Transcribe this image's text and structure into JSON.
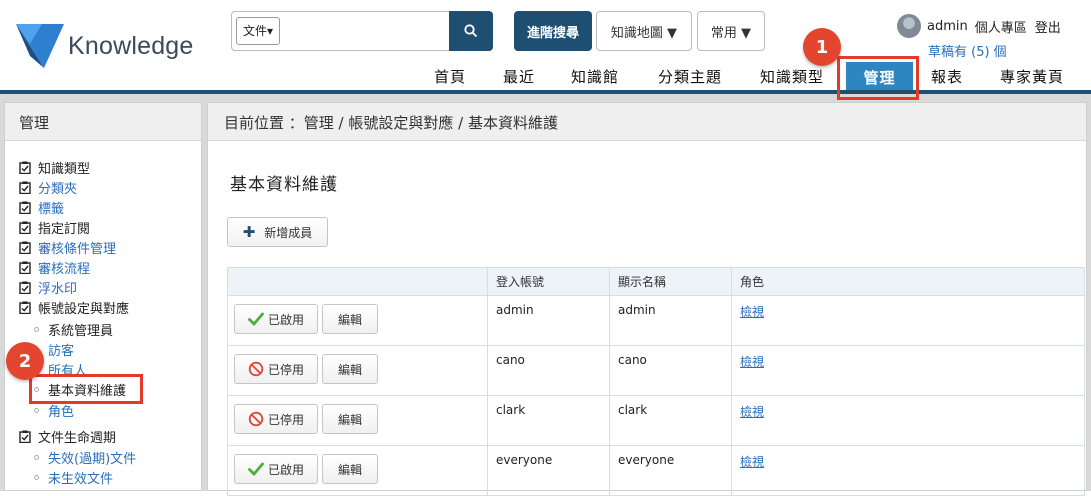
{
  "header": {
    "logo_text": "Knowledge",
    "search": {
      "select_value": "文件▾",
      "placeholder": ""
    },
    "advanced_search": "進階搜尋",
    "knowledge_map": "知識地圖 ▼",
    "common": "常用 ▼",
    "user": {
      "name": "admin",
      "profile": "個人專區",
      "logout": "登出"
    },
    "drafts": "草稿有 (5) 個",
    "nav": [
      "首頁",
      "最近",
      "知識館",
      "分類主題",
      "知識類型",
      "管理",
      "報表",
      "專家黃頁"
    ]
  },
  "annotations": {
    "badge1": "1",
    "badge2": "2"
  },
  "sidebar": {
    "title": "管理",
    "items": [
      {
        "label": "知識類型"
      },
      {
        "label": "分類夾"
      },
      {
        "label": "標籤"
      },
      {
        "label": "指定訂閱"
      },
      {
        "label": "審核條件管理"
      },
      {
        "label": "審核流程"
      },
      {
        "label": "浮水印"
      },
      {
        "label": "帳號設定與對應"
      },
      {
        "label": "文件生命週期"
      }
    ],
    "account_sub": [
      "系統管理員",
      "訪客",
      "所有人",
      "基本資料維護",
      "角色"
    ],
    "lifecycle_sub": [
      "失效(過期)文件",
      "未生效文件"
    ]
  },
  "main": {
    "breadcrumb": "目前位置 ：管理 / 帳號設定與對應 / 基本資料維護",
    "title": "基本資料維護",
    "add_button": "新增成員",
    "columns": [
      "",
      "登入帳號",
      "顯示名稱",
      "角色"
    ],
    "rows": [
      {
        "status": "已啟用",
        "status_type": "enabled",
        "edit": "編輯",
        "account": "admin",
        "display": "admin",
        "role": "檢視"
      },
      {
        "status": "已停用",
        "status_type": "disabled",
        "edit": "編輯",
        "account": "cano",
        "display": "cano",
        "role": "檢視"
      },
      {
        "status": "已停用",
        "status_type": "disabled",
        "edit": "編輯",
        "account": "clark",
        "display": "clark",
        "role": "檢視"
      },
      {
        "status": "已啟用",
        "status_type": "enabled",
        "edit": "編輯",
        "account": "everyone",
        "display": "everyone",
        "role": "檢視"
      }
    ]
  },
  "colors": {
    "primary": "#1f4e73",
    "nav_active": "#2e86c1",
    "annotation": "#e3452f",
    "link": "#2a6ebb"
  }
}
